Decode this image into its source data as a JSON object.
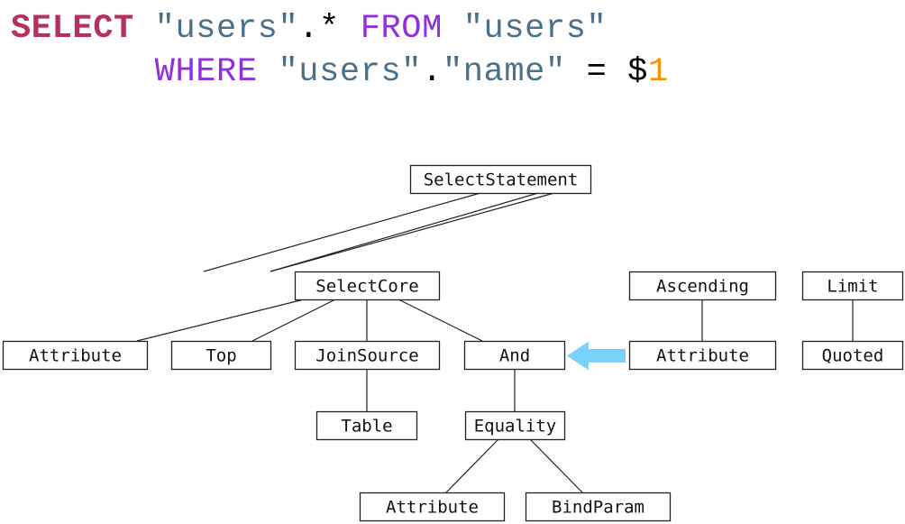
{
  "sql": {
    "line1": [
      {
        "text": "SELECT",
        "kind": "kw-select"
      },
      {
        "text": " ",
        "kind": "plain"
      },
      {
        "text": "\"users\"",
        "kind": "str"
      },
      {
        "text": ".* ",
        "kind": "plain"
      },
      {
        "text": "FROM",
        "kind": "kw"
      },
      {
        "text": " ",
        "kind": "plain"
      },
      {
        "text": "\"users\"",
        "kind": "str"
      }
    ],
    "line2": [
      {
        "text": "       ",
        "kind": "plain"
      },
      {
        "text": "WHERE",
        "kind": "kw"
      },
      {
        "text": " ",
        "kind": "plain"
      },
      {
        "text": "\"users\"",
        "kind": "str"
      },
      {
        "text": ".",
        "kind": "plain"
      },
      {
        "text": "\"name\"",
        "kind": "str"
      },
      {
        "text": " = $",
        "kind": "plain"
      },
      {
        "text": "1",
        "kind": "num"
      }
    ]
  },
  "colors": {
    "select_keyword": "#b5305f",
    "keyword": "#8f2fe0",
    "string": "#4b7088",
    "number": "#f59300",
    "arrow": "#78d2fb",
    "line": "#222222"
  },
  "tree": {
    "nodes": [
      {
        "id": "select-statement",
        "label": "SelectStatement"
      },
      {
        "id": "select-core",
        "label": "SelectCore"
      },
      {
        "id": "ascending",
        "label": "Ascending"
      },
      {
        "id": "limit",
        "label": "Limit"
      },
      {
        "id": "core-attribute",
        "label": "Attribute"
      },
      {
        "id": "top",
        "label": "Top"
      },
      {
        "id": "join-source",
        "label": "JoinSource"
      },
      {
        "id": "and",
        "label": "And"
      },
      {
        "id": "order-attribute",
        "label": "Attribute"
      },
      {
        "id": "quoted",
        "label": "Quoted"
      },
      {
        "id": "table",
        "label": "Table"
      },
      {
        "id": "equality",
        "label": "Equality"
      },
      {
        "id": "eq-attribute",
        "label": "Attribute"
      },
      {
        "id": "bind-param",
        "label": "BindParam"
      }
    ],
    "edges": [
      [
        "select-statement",
        "select-core"
      ],
      [
        "select-statement",
        "ascending"
      ],
      [
        "select-statement",
        "limit"
      ],
      [
        "select-core",
        "core-attribute"
      ],
      [
        "select-core",
        "top"
      ],
      [
        "select-core",
        "join-source"
      ],
      [
        "select-core",
        "and"
      ],
      [
        "ascending",
        "order-attribute"
      ],
      [
        "limit",
        "quoted"
      ],
      [
        "join-source",
        "table"
      ],
      [
        "and",
        "equality"
      ],
      [
        "equality",
        "eq-attribute"
      ],
      [
        "equality",
        "bind-param"
      ]
    ],
    "highlight_arrow": {
      "from": "order-attribute",
      "to": "and"
    }
  }
}
